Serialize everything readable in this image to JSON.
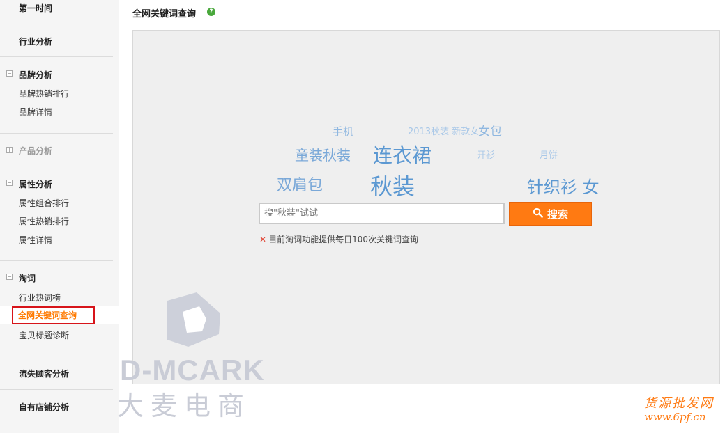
{
  "sidebar": {
    "top_item": "第一时间",
    "industry": "行业分析",
    "brand": {
      "title": "品牌分析",
      "toggle": "−",
      "items": [
        "品牌热销排行",
        "品牌详情"
      ]
    },
    "product": {
      "title": "产品分析",
      "toggle": "+"
    },
    "attribute": {
      "title": "属性分析",
      "toggle": "−",
      "items": [
        "属性组合排行",
        "属性热销排行",
        "属性详情"
      ]
    },
    "taoci": {
      "title": "淘词",
      "toggle": "−",
      "items": [
        "行业热词榜",
        "全网关键词查询",
        "宝贝标题诊断"
      ]
    },
    "churn": "流失顾客分析",
    "own_shop": "自有店铺分析"
  },
  "main": {
    "title": "全网关键词查询",
    "help_icon": "?",
    "word_cloud": [
      "手机",
      "2013秋装 新款女",
      "女包",
      "童装秋装",
      "连衣裙",
      "开衫",
      "月饼",
      "双肩包",
      "秋装",
      "针织衫 女"
    ],
    "search": {
      "placeholder": "搜\"秋装\"试试",
      "button_label": "搜索"
    },
    "notice_icon": "✕",
    "notice": "目前淘词功能提供每日100次关键词查询"
  },
  "watermarks": {
    "brand_en": "D-MCARK",
    "brand_cn": "大麦电商",
    "site_cn": "货源批发网",
    "site_url": "www.6pf.cn"
  },
  "colors": {
    "accent": "#ff7a12",
    "cloud": "#5b98d2",
    "cloud_light": "#a9c8e8",
    "active_border": "#d7141a",
    "help": "#49a83c"
  }
}
